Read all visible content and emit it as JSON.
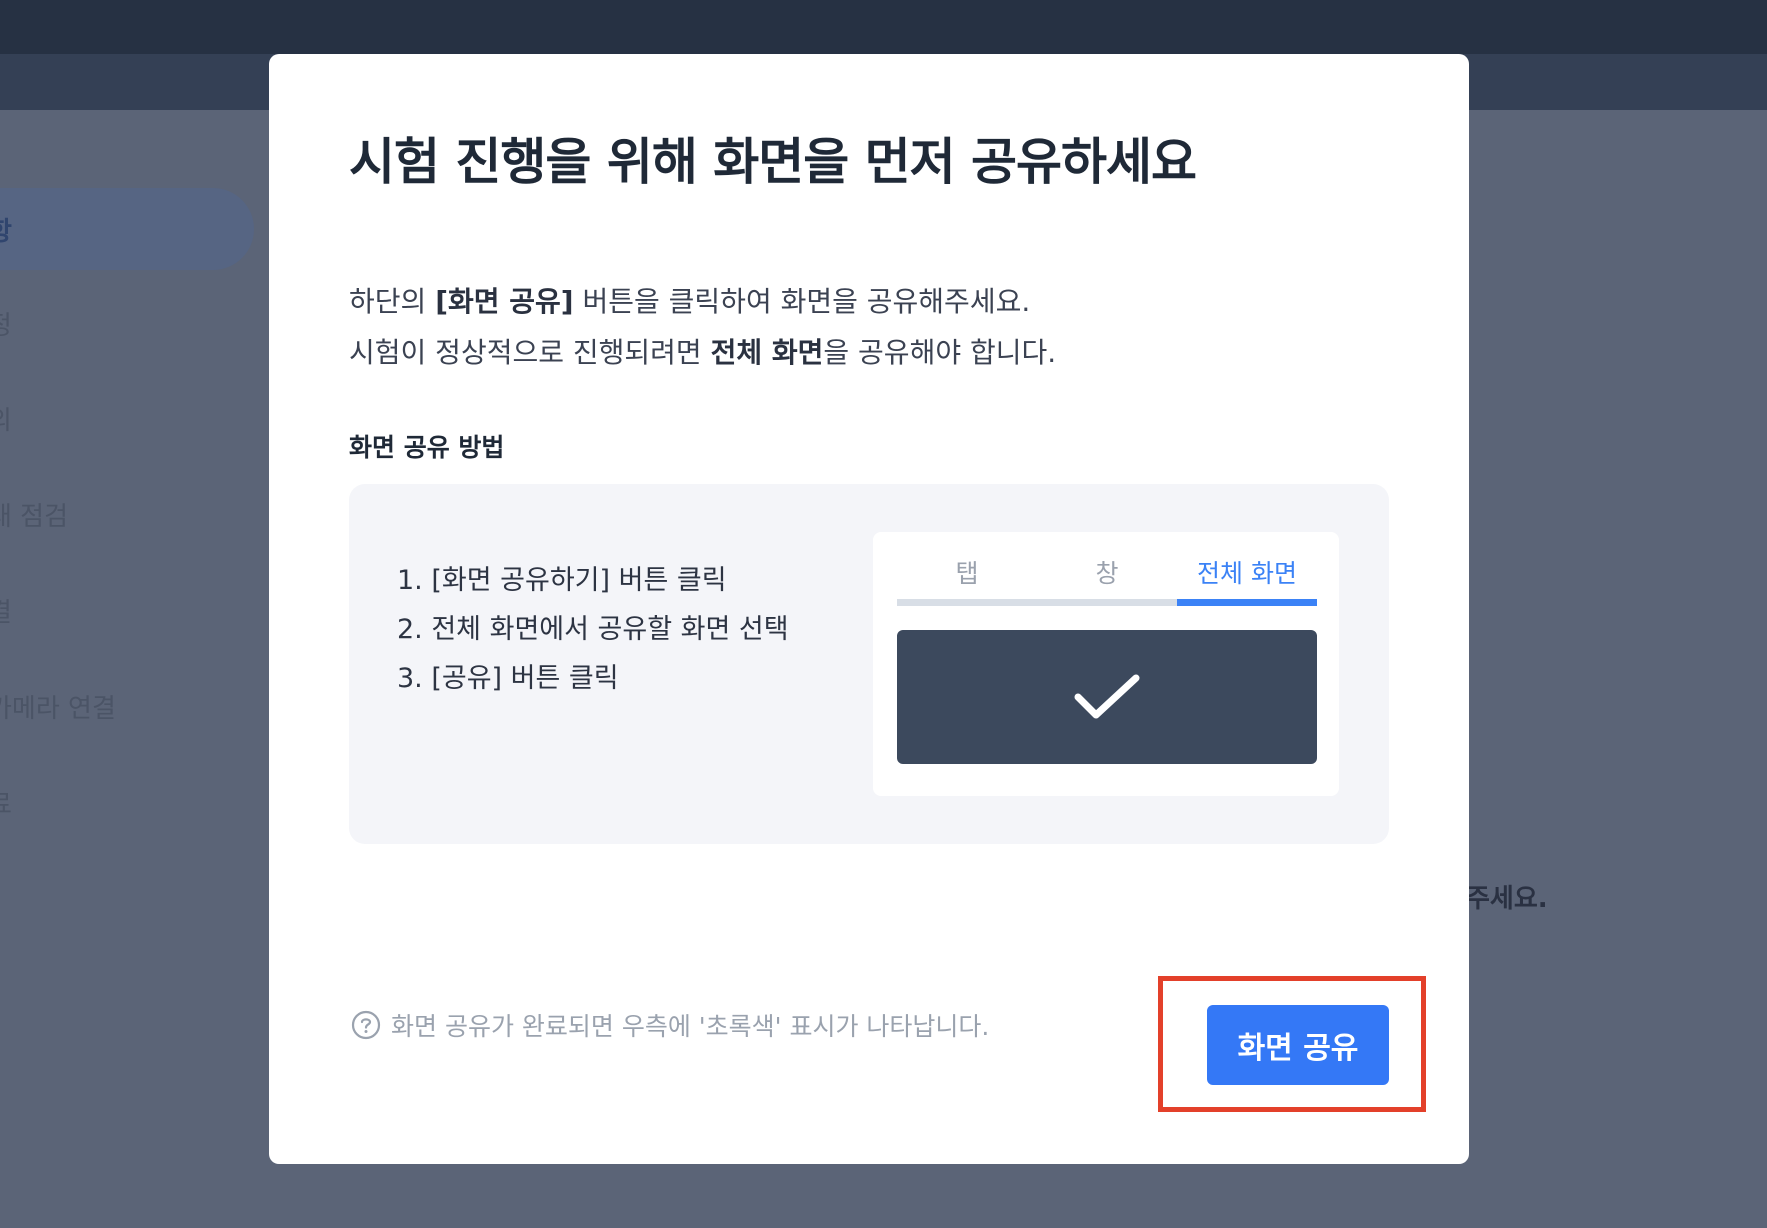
{
  "background": {
    "sidebar": {
      "items": [
        {
          "label": "항",
          "active": true
        },
        {
          "label": "정",
          "active": false
        },
        {
          "label": "의",
          "active": false
        },
        {
          "label": "태 점검",
          "active": false
        },
        {
          "label": "결",
          "active": false
        },
        {
          "label": "카메라 연결",
          "active": false
        },
        {
          "label": "료",
          "active": false
        }
      ]
    },
    "content_text": "주세요."
  },
  "modal": {
    "title": "시험 진행을 위해 화면을 먼저 공유하세요",
    "description": {
      "line1_prefix": "하단의 ",
      "line1_bold": "[화면 공유]",
      "line1_suffix": " 버튼을 클릭하여 화면을 공유해주세요.",
      "line2_prefix": "시험이 정상적으로 진행되려면 ",
      "line2_bold": "전체 화면",
      "line2_suffix": "을 공유해야 합니다."
    },
    "howto": {
      "label": "화면 공유 방법",
      "steps": [
        "1. [화면 공유하기] 버튼 클릭",
        "2. 전체 화면에서 공유할 화면 선택",
        "3. [공유] 버튼 클릭"
      ],
      "mock": {
        "tabs": [
          {
            "label": "탭",
            "selected": false
          },
          {
            "label": "창",
            "selected": false
          },
          {
            "label": "전체 화면",
            "selected": true
          }
        ],
        "screen_icon": "checkmark-icon"
      }
    },
    "hint": {
      "icon": "question-circle-icon",
      "text": "화면 공유가 완료되면 우측에 '초록색' 표시가 나타납니다."
    },
    "share_button": {
      "label": "화면 공유"
    }
  },
  "colors": {
    "accent": "#3478f6",
    "highlight": "#e3402a",
    "overlay": "#5b6477"
  }
}
